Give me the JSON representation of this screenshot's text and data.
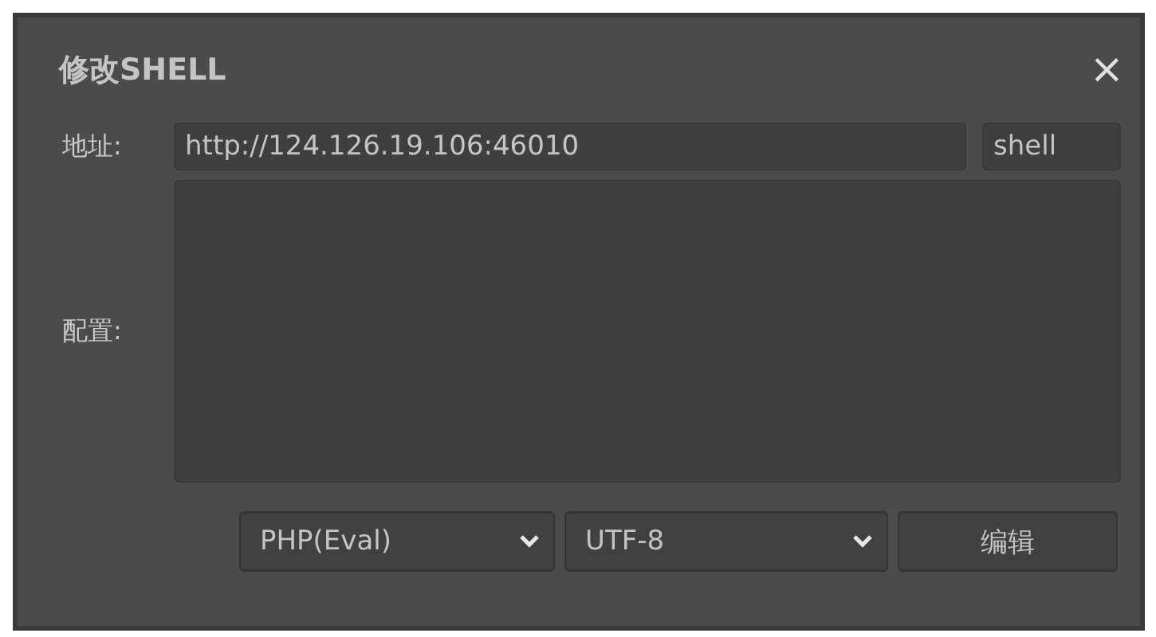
{
  "window": {
    "title": "修改SHELL",
    "close": "×"
  },
  "address": {
    "label": "地址:",
    "value": "http://124.126.19.106:46010",
    "password": "shell"
  },
  "config": {
    "label": "配置:"
  },
  "footer": {
    "type_select": "PHP(Eval)",
    "encoding_select": "UTF-8",
    "button": "编辑"
  }
}
